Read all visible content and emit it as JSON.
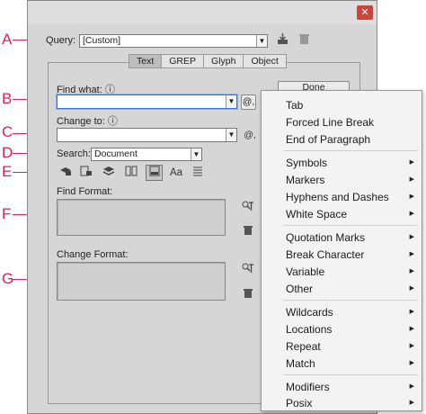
{
  "callouts": [
    "A",
    "B",
    "C",
    "D",
    "E",
    "F",
    "G"
  ],
  "dialog": {
    "close_glyph": "✕",
    "query_label": "Query:",
    "query_value": "[Custom]",
    "tabs": [
      {
        "label": "Text",
        "active": true
      },
      {
        "label": "GREP",
        "active": false
      },
      {
        "label": "Glyph",
        "active": false
      },
      {
        "label": "Object",
        "active": false
      }
    ],
    "find_what_label": "Find what:",
    "change_to_label": "Change to:",
    "info_glyph": "ⓘ",
    "done_label": "Done",
    "at_glyph": "@,",
    "search_label": "Search:",
    "search_value": "Document",
    "option_icons": [
      "lock-layers-icon",
      "lock-stories-icon",
      "hidden-layers-icon",
      "master-pages-icon",
      "footnotes-icon",
      "case-sensitive-icon",
      "whole-word-icon"
    ],
    "case_sensitive_glyph": "Aa",
    "find_format_label": "Find Format:",
    "change_format_label": "Change Format:"
  },
  "special_menu": {
    "groups": [
      [
        {
          "label": "Tab",
          "submenu": false
        },
        {
          "label": "Forced Line Break",
          "submenu": false
        },
        {
          "label": "End of Paragraph",
          "submenu": false
        }
      ],
      [
        {
          "label": "Symbols",
          "submenu": true
        },
        {
          "label": "Markers",
          "submenu": true
        },
        {
          "label": "Hyphens and Dashes",
          "submenu": true
        },
        {
          "label": "White Space",
          "submenu": true
        }
      ],
      [
        {
          "label": "Quotation Marks",
          "submenu": true
        },
        {
          "label": "Break Character",
          "submenu": true
        },
        {
          "label": "Variable",
          "submenu": true
        },
        {
          "label": "Other",
          "submenu": true
        }
      ],
      [
        {
          "label": "Wildcards",
          "submenu": true
        },
        {
          "label": "Locations",
          "submenu": true
        },
        {
          "label": "Repeat",
          "submenu": true
        },
        {
          "label": "Match",
          "submenu": true
        }
      ],
      [
        {
          "label": "Modifiers",
          "submenu": true
        },
        {
          "label": "Posix",
          "submenu": true
        }
      ]
    ]
  }
}
